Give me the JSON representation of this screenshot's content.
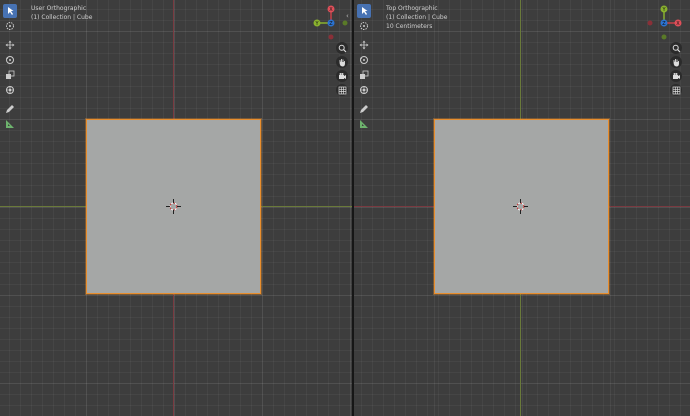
{
  "colors": {
    "viewport_bg": "#3d3d3d",
    "cube_face": "#a5a7a6",
    "cube_outline": "#e88e2e",
    "x_axis": "#c8414a",
    "y_axis": "#8ab22e",
    "z_axis": "#2a73d2",
    "active_tool": "#4772b3"
  },
  "left_viewport": {
    "view_name": "User Orthographic",
    "collection": "(1) Collection | Cube",
    "gizmo": {
      "x_label": "X",
      "y_label": "Y",
      "z_label": "Z"
    }
  },
  "right_viewport": {
    "view_name": "Top Orthographic",
    "collection": "(1) Collection | Cube",
    "scale": "10 Centimeters",
    "gizmo": {
      "x_label": "X",
      "y_label": "Y",
      "z_label": "Z"
    }
  },
  "toolbar_tools": [
    "select-box-icon",
    "cursor-icon",
    "move-icon",
    "rotate-icon",
    "scale-icon",
    "transform-icon",
    "annotate-icon",
    "measure-icon"
  ],
  "nav_tools": [
    "zoom-icon",
    "hand-pan-icon",
    "camera-icon",
    "grid-toggle-icon"
  ]
}
